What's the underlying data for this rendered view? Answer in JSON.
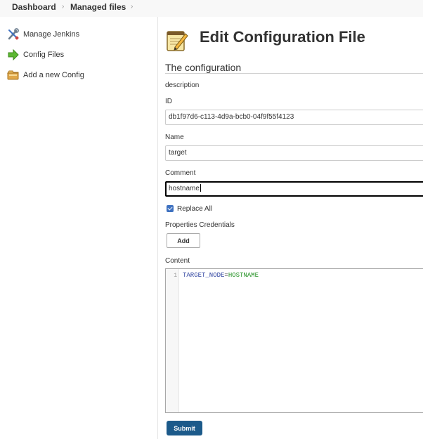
{
  "breadcrumb": {
    "items": [
      "Dashboard",
      "Managed files"
    ]
  },
  "sidebar": {
    "items": [
      {
        "label": "Manage Jenkins",
        "icon": "wrench-screwdriver-icon"
      },
      {
        "label": "Config Files",
        "icon": "green-arrow-icon"
      },
      {
        "label": "Add a new Config",
        "icon": "folder-add-icon"
      }
    ]
  },
  "main": {
    "title": "Edit Configuration File",
    "title_icon": "notepad-pencil-icon",
    "section_title": "The configuration",
    "description_label": "description",
    "id": {
      "label": "ID",
      "value": "db1f97d6-c113-4d9a-bcb0-04f9f55f4123"
    },
    "name": {
      "label": "Name",
      "value": "target"
    },
    "comment": {
      "label": "Comment",
      "value": "hostname"
    },
    "replace_all": {
      "label": "Replace All",
      "checked": true
    },
    "properties_credentials": {
      "label": "Properties Credentials",
      "add_label": "Add"
    },
    "content": {
      "label": "Content",
      "line_number": "1",
      "key": "TARGET_NODE",
      "equals": "=",
      "value": "HOSTNAME"
    },
    "submit_label": "Submit"
  },
  "colors": {
    "accent": "#3e71c0",
    "submit": "#1c5a8a",
    "code_key": "#2a3f9e",
    "code_value": "#1e8e1e"
  }
}
